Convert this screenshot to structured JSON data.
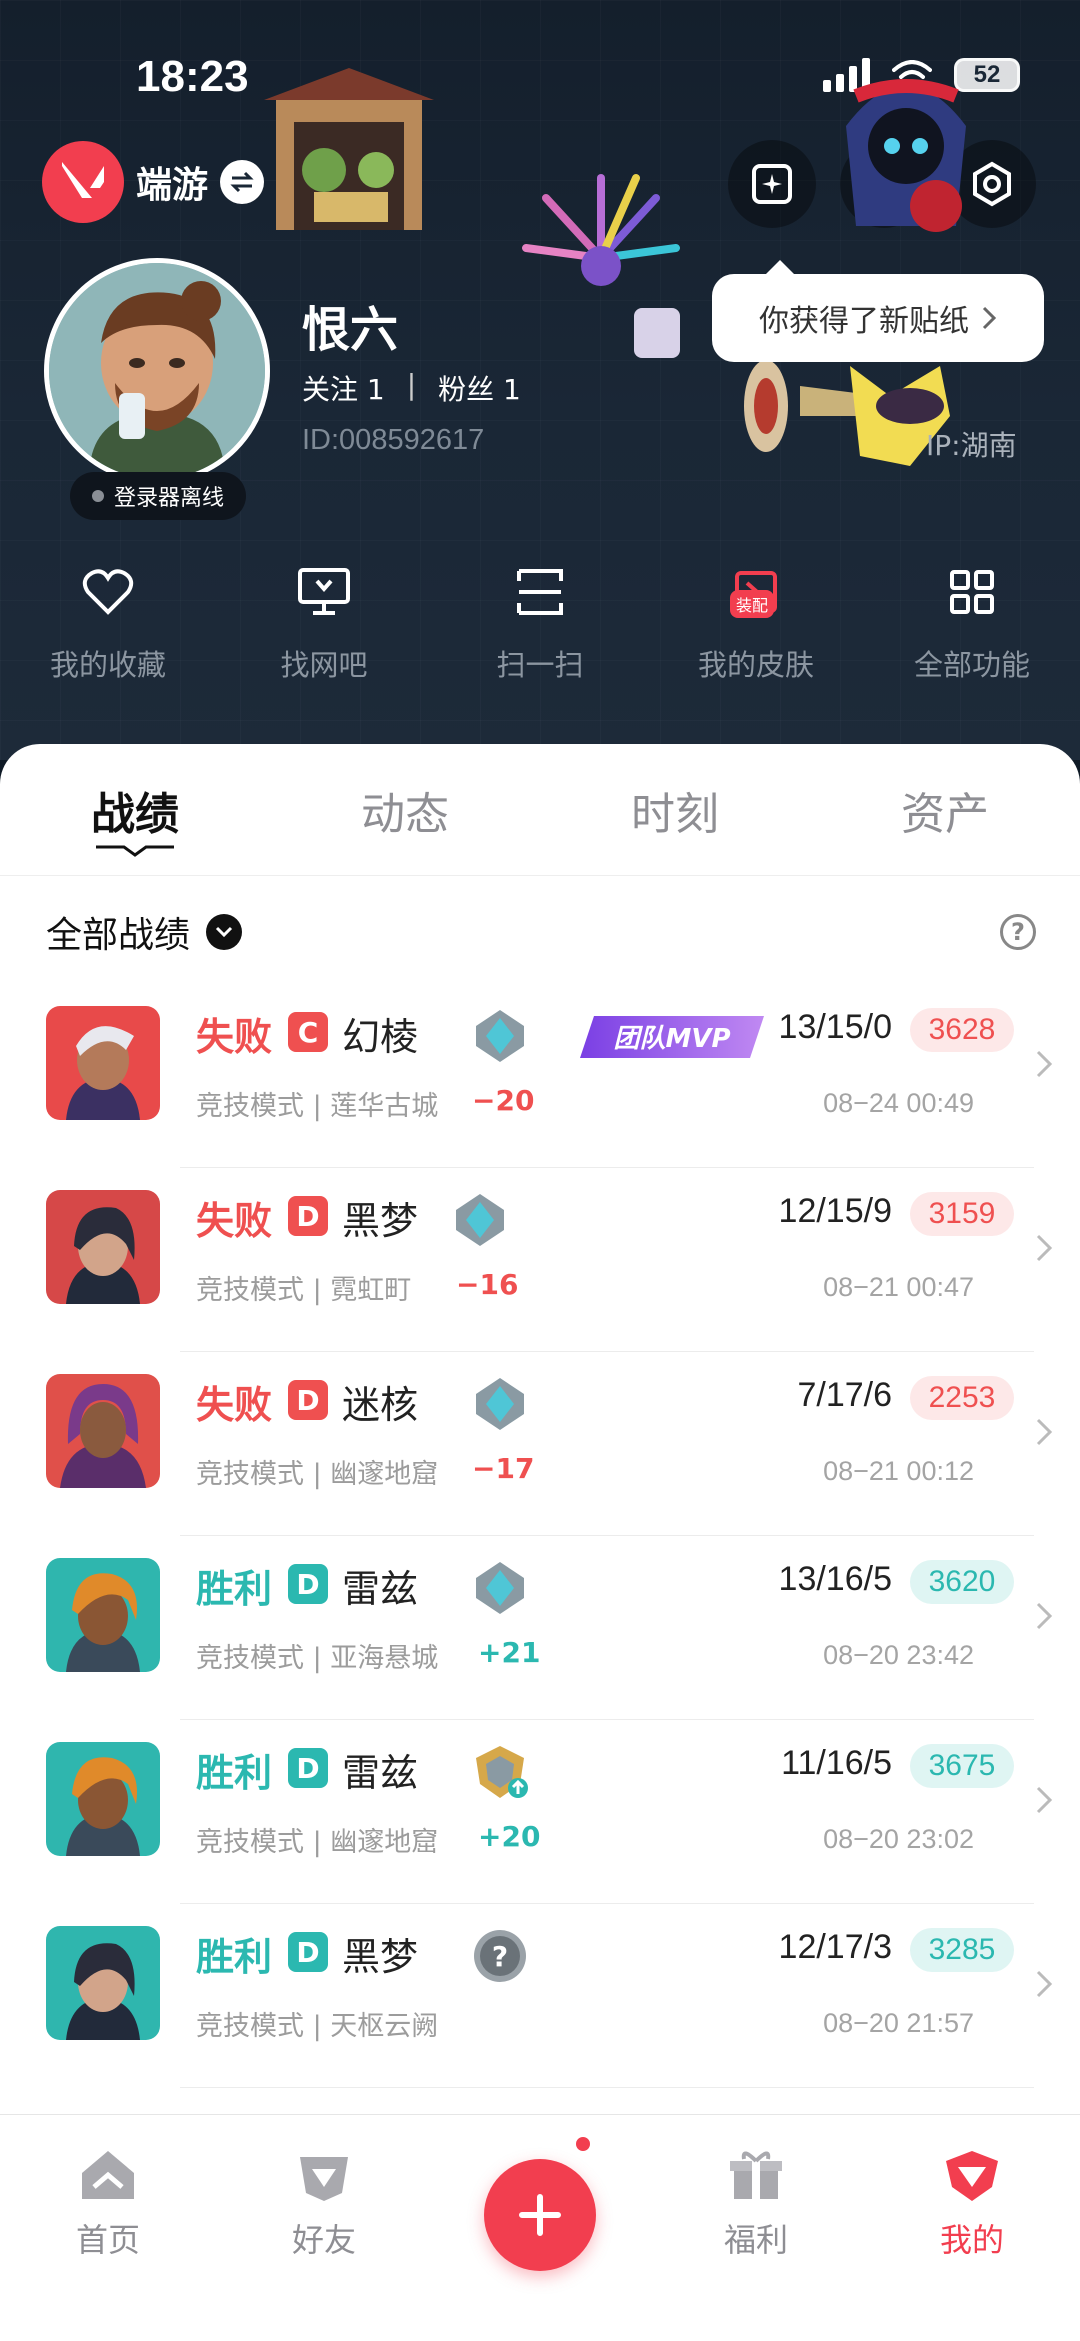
{
  "status": {
    "time": "18:23",
    "battery": "52"
  },
  "brand": {
    "name": "端游"
  },
  "sticker_tip": {
    "text": "你获得了新贴纸"
  },
  "profile": {
    "name": "恨六",
    "follow": "关注 1",
    "separator": "|",
    "fans": "粉丝 1",
    "id": "ID:008592617",
    "ip": "IP:湖南",
    "launcher_status": "登录器离线"
  },
  "quick_menu": [
    {
      "label": "我的收藏",
      "icon": "heart-icon"
    },
    {
      "label": "找网吧",
      "icon": "monitor-icon"
    },
    {
      "label": "扫一扫",
      "icon": "scan-icon"
    },
    {
      "label": "我的皮肤",
      "icon": "skin-icon",
      "badge": "装配"
    },
    {
      "label": "全部功能",
      "icon": "grid-icon"
    }
  ],
  "tabs": [
    "战绩",
    "动态",
    "时刻",
    "资产"
  ],
  "filter": {
    "label": "全部战绩"
  },
  "matches": [
    {
      "result": "失败",
      "grade": "C",
      "agent": "幻棱",
      "mode_map": "竞技模式 | 莲华古城",
      "rr": "−20",
      "kda": "13/15/0",
      "score": "3628",
      "time": "08−24 00:49",
      "mvp": "团队MVP",
      "outcome": "loss"
    },
    {
      "result": "失败",
      "grade": "D",
      "agent": "黑梦",
      "mode_map": "竞技模式 | 霓虹町",
      "rr": "−16",
      "kda": "12/15/9",
      "score": "3159",
      "time": "08−21 00:47",
      "outcome": "loss"
    },
    {
      "result": "失败",
      "grade": "D",
      "agent": "迷核",
      "mode_map": "竞技模式 | 幽邃地窟",
      "rr": "−17",
      "kda": "7/17/6",
      "score": "2253",
      "time": "08−21 00:12",
      "outcome": "loss"
    },
    {
      "result": "胜利",
      "grade": "D",
      "agent": "雷兹",
      "mode_map": "竞技模式 | 亚海悬城",
      "rr": "+21",
      "kda": "13/16/5",
      "score": "3620",
      "time": "08−20 23:42",
      "outcome": "win"
    },
    {
      "result": "胜利",
      "grade": "D",
      "agent": "雷兹",
      "mode_map": "竞技模式 | 幽邃地窟",
      "rr": "+20",
      "kda": "11/16/5",
      "score": "3675",
      "time": "08−20 23:02",
      "outcome": "win"
    },
    {
      "result": "胜利",
      "grade": "D",
      "agent": "黑梦",
      "mode_map": "竞技模式 | 天枢云阙",
      "rr": "",
      "kda": "12/17/3",
      "score": "3285",
      "time": "08−20 21:57",
      "outcome": "win"
    }
  ],
  "nav": [
    {
      "label": "首页",
      "icon": "home-icon"
    },
    {
      "label": "好友",
      "icon": "friends-icon"
    },
    {
      "label": "",
      "icon": "plus-icon"
    },
    {
      "label": "福利",
      "icon": "gift-icon"
    },
    {
      "label": "我的",
      "icon": "profile-icon"
    }
  ],
  "colors": {
    "accent": "#f23e4f",
    "loss": "#ef5050",
    "win": "#2bb8b0",
    "header_bg": "#1a2736"
  }
}
